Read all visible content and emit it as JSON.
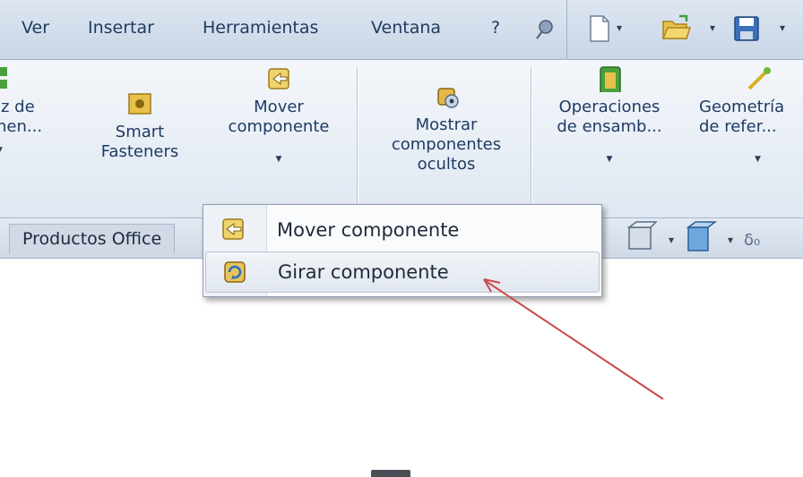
{
  "menu": {
    "items": [
      "Ver",
      "Insertar",
      "Herramientas",
      "Ventana",
      "?"
    ]
  },
  "quick_access": {
    "icons": [
      "pushpin-icon",
      "new-document-icon",
      "open-folder-icon",
      "save-icon"
    ]
  },
  "ribbon": {
    "buttons": [
      {
        "name": "matriz-componente",
        "line1": "iz de",
        "line2": "nen...",
        "icon": "pattern-icon"
      },
      {
        "name": "smart-fasteners",
        "line1": "Smart",
        "line2": "Fasteners",
        "icon": "smart-fasteners-icon"
      },
      {
        "name": "mover-componente",
        "line1": "Mover",
        "line2": "componente",
        "icon": "move-component-icon"
      },
      {
        "name": "mostrar-ocultos",
        "line1": "Mostrar",
        "line2": "componentes",
        "line3": "ocultos",
        "icon": "show-hidden-icon"
      },
      {
        "name": "operaciones-ensamblaje",
        "line1": "Operaciones",
        "line2": "de ensamb...",
        "icon": "assembly-features-icon"
      },
      {
        "name": "geometria-referencia",
        "line1": "Geometría",
        "line2": "de refer...",
        "icon": "reference-geometry-icon"
      }
    ]
  },
  "tabs": {
    "active": "Productos Office"
  },
  "dropdown": {
    "items": [
      {
        "label": "Mover componente",
        "icon": "move-component-icon"
      },
      {
        "label": "Girar componente",
        "icon": "rotate-component-icon"
      }
    ]
  },
  "colors": {
    "accent": "#1e3b63",
    "arrow": "#c94a4a"
  }
}
